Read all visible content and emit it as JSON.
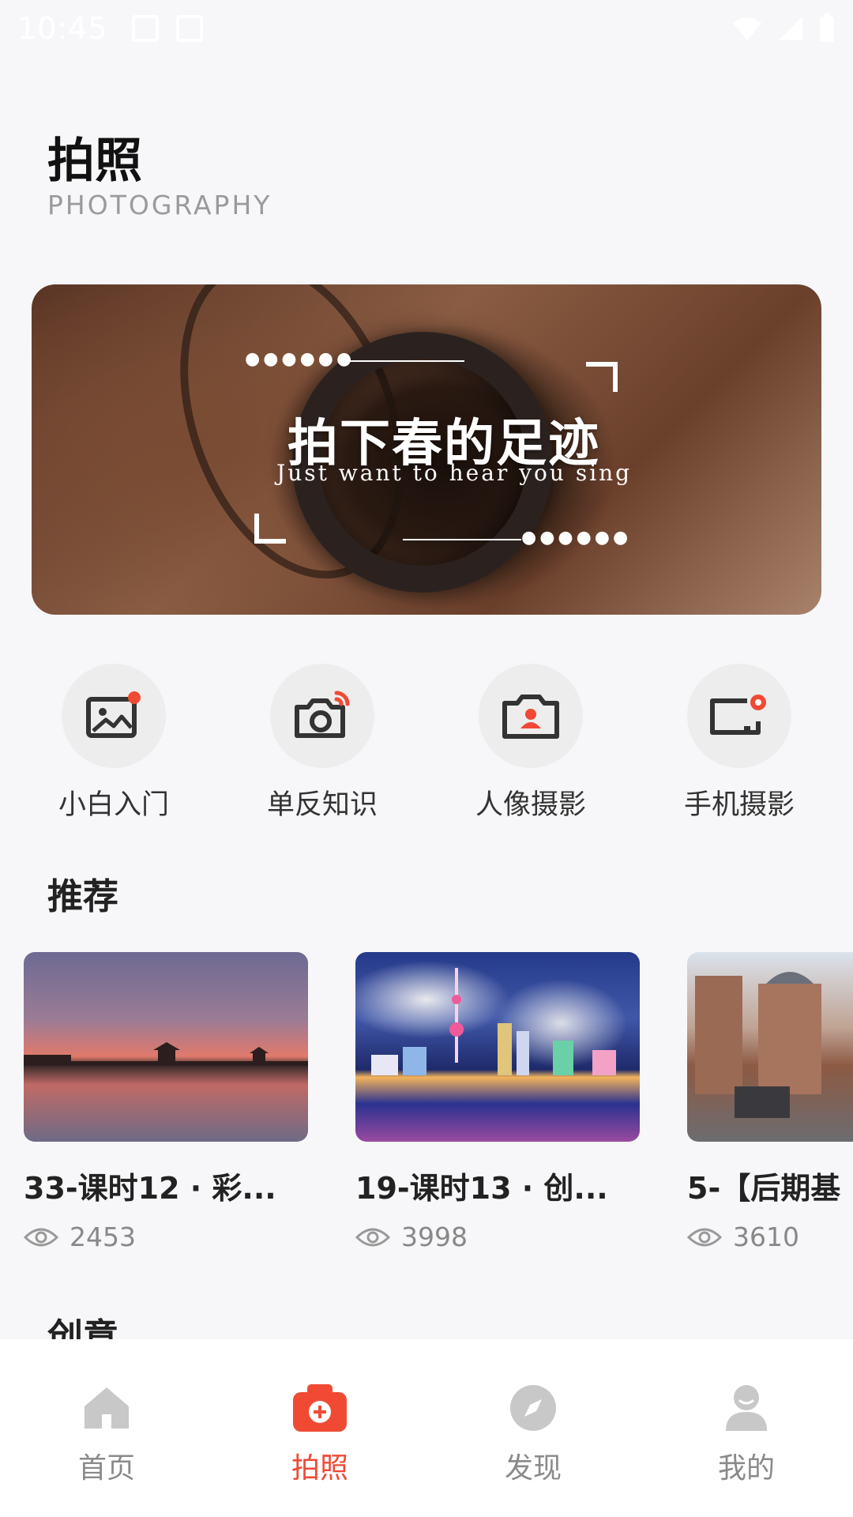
{
  "status_bar": {
    "time": "10:45"
  },
  "header": {
    "title": "拍照",
    "subtitle": "PHOTOGRAPHY"
  },
  "banner": {
    "title": "拍下春的足迹",
    "tagline": "Just want to hear you sing"
  },
  "categories": [
    {
      "label": "小白入门",
      "icon": "picture-icon"
    },
    {
      "label": "单反知识",
      "icon": "camera-icon"
    },
    {
      "label": "人像摄影",
      "icon": "portrait-camera-icon"
    },
    {
      "label": "手机摄影",
      "icon": "phone-camera-icon"
    }
  ],
  "recommended": {
    "heading": "推荐",
    "cards": [
      {
        "title": "33-课时12 · 彩...",
        "views": "2453"
      },
      {
        "title": "19-课时13 · 创...",
        "views": "3998"
      },
      {
        "title": "5-【后期基",
        "views": "3610"
      }
    ]
  },
  "next_section": {
    "heading": "创意"
  },
  "bottom_nav": [
    {
      "label": "首页",
      "icon": "home-icon",
      "active": false
    },
    {
      "label": "拍照",
      "icon": "camera-plus-icon",
      "active": true
    },
    {
      "label": "发现",
      "icon": "compass-icon",
      "active": false
    },
    {
      "label": "我的",
      "icon": "user-icon",
      "active": false
    }
  ],
  "colors": {
    "accent": "#f04a35",
    "icon_dark": "#333333",
    "nav_inactive": "#c8c8c8"
  }
}
